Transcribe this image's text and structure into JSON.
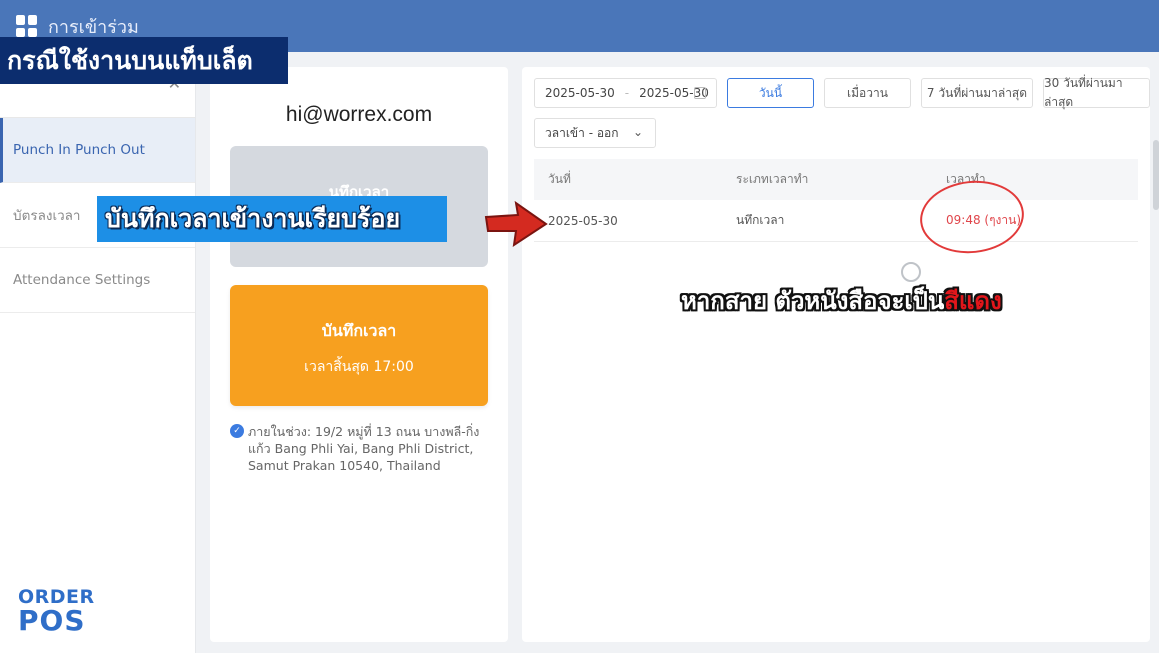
{
  "topbar": {
    "title": "การเข้าร่วม",
    "icon": "grid-icon"
  },
  "sidebar": {
    "items": [
      {
        "label": "Punch In Punch Out",
        "active": true
      },
      {
        "label": "บัตรลงเวลา",
        "active": false
      },
      {
        "label": "Attendance Settings",
        "active": false
      }
    ]
  },
  "logo": {
    "line1": "ORDER",
    "line2": "POS"
  },
  "punch": {
    "email": "hi@worrex.com",
    "card1_title": "นทึกเวลา",
    "card2_title": "บันทึกเวลา",
    "card2_sub": "เวลาสิ้นสุด 17:00",
    "location": "ภายในช่วง: 19/2 หมู่ที่ 13 ถนน บางพลี-กิ่งแก้ว Bang Phli Yai, Bang Phli District, Samut Prakan 10540, Thailand"
  },
  "filters": {
    "date_from": "2025-05-30",
    "date_sep": "-",
    "date_to": "2025-05-30",
    "today": "วันนี้",
    "yesterday": "เมื่อวาน",
    "last7": "7 วันที่ผ่านมาล่าสุด",
    "last30": "30 วันที่ผ่านมาล่าสุด",
    "type_select": "วลาเข้า - ออก"
  },
  "table": {
    "headers": [
      "วันที่",
      "ระเภทเวลาทำ",
      "เวลาทำ"
    ],
    "rows": [
      {
        "date": "2025-05-30",
        "type": "นทึกเวลา",
        "time": "09:48 (ๆงาน)"
      }
    ]
  },
  "overlays": {
    "tablet": "กรณีใช้งานบนแท็บเล็ต",
    "saved": "บันทึกเวลาเข้างานเรียบร้อย",
    "note_prefix": "หากสาย ตัวหนังสือจะเป็น",
    "note_red": "สีแดง"
  },
  "colors": {
    "topbar": "#4a76b9",
    "accent": "#3b7be0",
    "orange": "#f7a01f",
    "late": "#e0464b"
  }
}
